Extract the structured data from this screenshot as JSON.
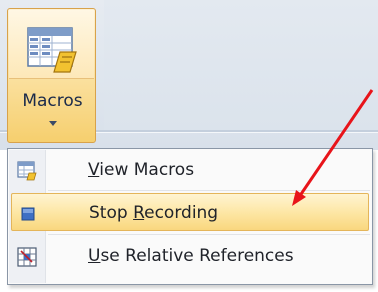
{
  "ribbon": {
    "macros_button": {
      "label": "Macros",
      "icon": "macros-icon"
    }
  },
  "menu": {
    "items": [
      {
        "label": "View Macros",
        "mnemonic": "V",
        "rest": "iew Macros",
        "icon": "view-macros-icon",
        "highlighted": false
      },
      {
        "label": "Stop Recording",
        "prefix": "Stop ",
        "mnemonic": "R",
        "rest": "ecording",
        "icon": "stop-recording-icon",
        "highlighted": true
      },
      {
        "label": "Use Relative References",
        "mnemonic": "U",
        "rest": "se Relative References",
        "icon": "relative-references-icon",
        "highlighted": false
      }
    ]
  },
  "annotation": {
    "arrow_color": "#e8141a"
  }
}
